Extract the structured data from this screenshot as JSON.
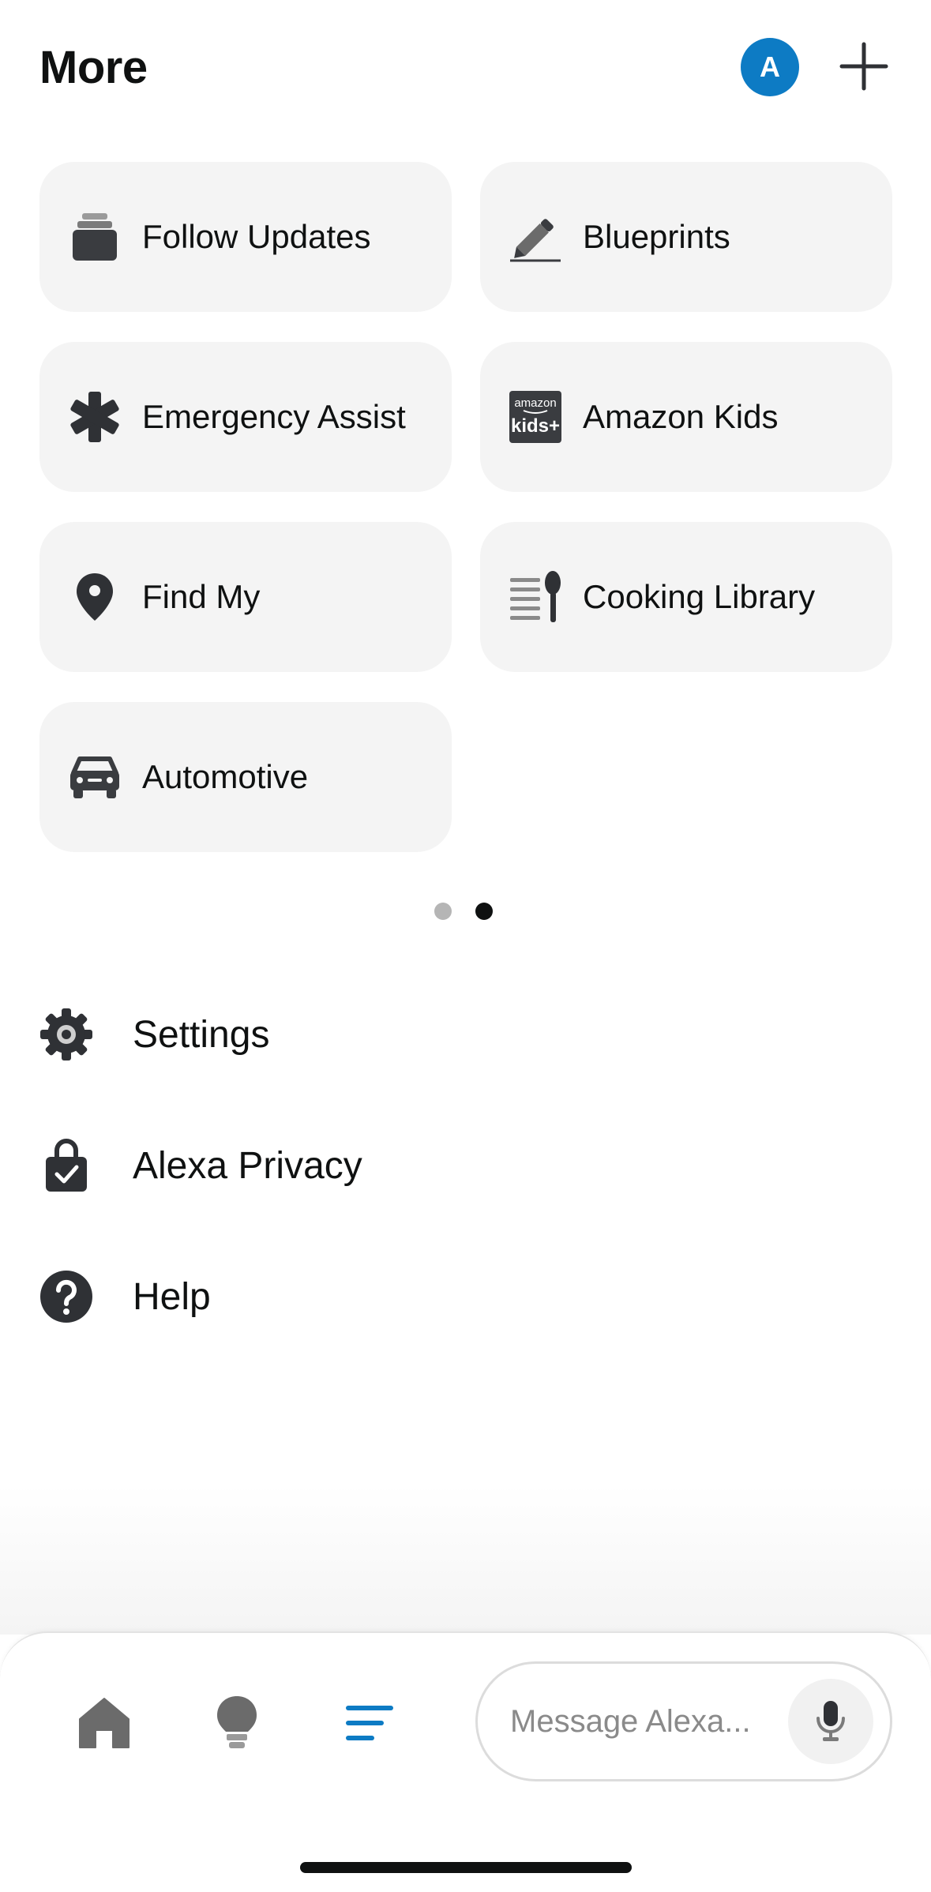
{
  "header": {
    "title": "More",
    "avatar_letter": "A",
    "add_icon": "plus-icon"
  },
  "tiles": [
    {
      "label": "Follow Updates",
      "icon": "stack-icon"
    },
    {
      "label": "Blueprints",
      "icon": "pencil-icon"
    },
    {
      "label": "Emergency Assist",
      "icon": "asterisk-icon"
    },
    {
      "label": "Amazon Kids",
      "icon": "amazon-kids-logo",
      "logo_text_top": "amazon",
      "logo_text_bottom": "kids+"
    },
    {
      "label": "Find My",
      "icon": "location-pin-icon"
    },
    {
      "label": "Cooking Library",
      "icon": "spoon-list-icon"
    },
    {
      "label": "Automotive",
      "icon": "car-icon"
    }
  ],
  "pager": {
    "page_count": 2,
    "active_page": 2,
    "active_color": "#0f1111",
    "inactive_color": "#b5b5b5"
  },
  "menu": [
    {
      "label": "Settings",
      "icon": "gear-icon"
    },
    {
      "label": "Alexa Privacy",
      "icon": "privacy-lock-icon"
    },
    {
      "label": "Help",
      "icon": "help-icon"
    }
  ],
  "bottom_nav": {
    "items": [
      {
        "icon": "home-icon",
        "active": false
      },
      {
        "icon": "lightbulb-icon",
        "active": false
      },
      {
        "icon": "more-menu-icon",
        "active": true
      }
    ],
    "message_placeholder": "Message Alexa...",
    "mic_icon": "microphone-icon"
  },
  "colors": {
    "accent": "#0d7bc4",
    "tile_bg": "#f4f4f4",
    "icon_dark": "#2f3135",
    "icon_gray": "#6b6b6b"
  }
}
